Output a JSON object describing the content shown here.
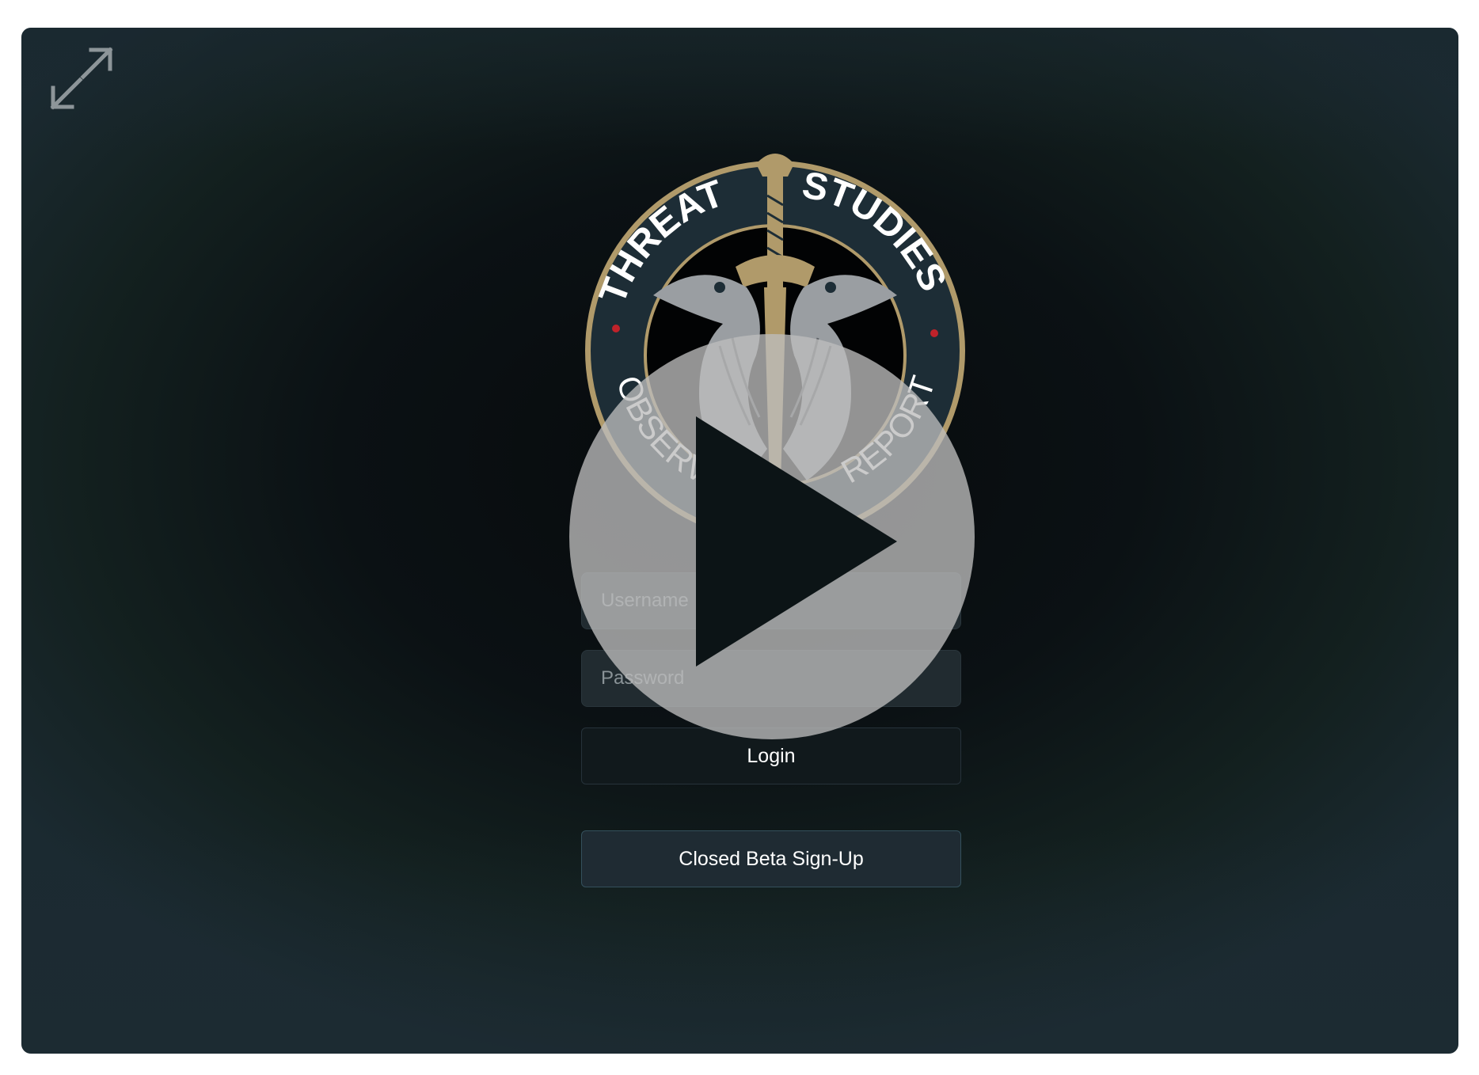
{
  "window": {
    "expand_icon": "expand-arrows-icon"
  },
  "emblem": {
    "icon": "threat-studies-emblem",
    "top_left_text": "THREAT",
    "top_right_text": "STUDIES",
    "bottom_left_text": "OBSERVE",
    "bottom_right_text": "REPORT",
    "gold": "#b09a6a",
    "navy": "#1a2a33",
    "red_dot": "#c0222a"
  },
  "login_form": {
    "username_placeholder": "Username",
    "password_placeholder": "Password",
    "login_label": "Login",
    "beta_label": "Closed Beta Sign-Up"
  },
  "video_overlay": {
    "icon": "play-icon"
  }
}
